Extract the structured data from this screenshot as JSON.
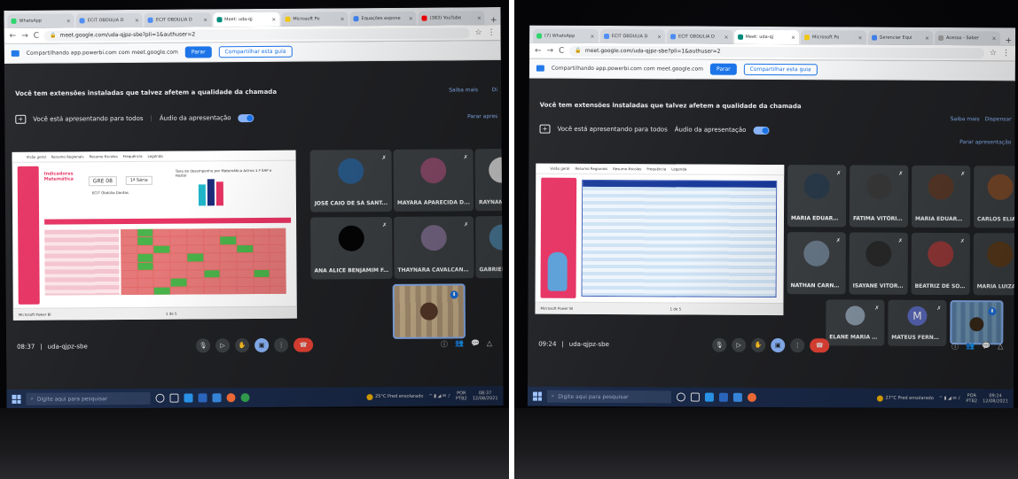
{
  "photo1": {
    "browser": {
      "tabs": [
        {
          "label": "WhatsApp",
          "color": "#25d366"
        },
        {
          "label": "ECIT OBDÚLIA D",
          "color": "#4a8af4"
        },
        {
          "label": "ECIT OBDÚLIA D",
          "color": "#4a8af4"
        },
        {
          "label": "Meet: uda-qj",
          "color": "#00897b",
          "active": true
        },
        {
          "label": "Microsoft Po",
          "color": "#f2c811"
        },
        {
          "label": "Equações expone",
          "color": "#4285f4"
        },
        {
          "label": "(383) YouTube",
          "color": "#ff0000"
        }
      ],
      "new_tab": "+",
      "url": "meet.google.com/uda-qjpz-sbe?pli=1&authuser=2"
    },
    "share_bar": {
      "text": "Compartilhando app.powerbi.com com meet.google.com",
      "stop_label": "Parar",
      "share_tab_label": "Compartilhar esta guia"
    },
    "meet": {
      "warning": "Você tem extensões instaladas que talvez afetem a qualidade da chamada",
      "learn_more": "Saiba mais",
      "dismiss": "Di",
      "presenting": "Você está apresentando para todos",
      "audio_label": "Áudio da apresentação",
      "stop_presenting": "Parar apres",
      "slide": {
        "nav": [
          "Visão geral",
          "Resumo Regionais",
          "Resumo Escolas",
          "Frequência",
          "Legenda"
        ],
        "title": "Indicadores Matemática",
        "gre": "GRE 08",
        "serie": "1ª Série",
        "school": "ECIT Obdúlia Dantas",
        "chart_caption": "Taxa de desempenho por Matemática Acima 1.ª SAP e Hostel",
        "footer_left": "Microsoft Power BI",
        "footer_mid": "1 de 5"
      },
      "participants": [
        {
          "name": "JOSÉ CAIO DE SÁ SANT...",
          "avatar": "#2a5a8a"
        },
        {
          "name": "MAYARA APARECIDA D...",
          "avatar": "#8a4a6a"
        },
        {
          "name": "RAYNAN VERAS DE",
          "avatar": "#cfcfcf"
        },
        {
          "name": "ANA ALICE BENJAMIM F...",
          "avatar": "#050505"
        },
        {
          "name": "THAYNARA CAVALCANT...",
          "avatar": "#7a6a8a"
        },
        {
          "name": "GABRIEL OLIVEIRA S",
          "avatar": "#4a7a9a"
        }
      ],
      "time": "08:37",
      "meeting_code": "uda-qjpz-sbe"
    },
    "taskbar": {
      "search_placeholder": "Digite aqui para pesquisar",
      "weather": "25°C Pred ensolarado",
      "lang": "POR",
      "lang2": "PTB2",
      "clock_time": "08:37",
      "clock_date": "12/08/2021"
    }
  },
  "photo2": {
    "browser": {
      "tabs": [
        {
          "label": "(7) WhatsApp",
          "color": "#25d366"
        },
        {
          "label": "ECIT OBDÚLIA D",
          "color": "#4a8af4"
        },
        {
          "label": "ECIT OBDÚLIA D",
          "color": "#4a8af4"
        },
        {
          "label": "Meet: uda-qj",
          "color": "#00897b",
          "active": true
        },
        {
          "label": "Microsoft Po",
          "color": "#f2c811"
        },
        {
          "label": "Gerenciar Equi",
          "color": "#4285f4"
        },
        {
          "label": "Acesso - Saber",
          "color": "#9e9e9e"
        }
      ],
      "new_tab": "+",
      "url": "meet.google.com/uda-qjpz-sbe?pli=1&authuser=2"
    },
    "share_bar": {
      "text": "Compartilhando app.powerbi.com com meet.google.com",
      "stop_label": "Parar",
      "share_tab_label": "Compartilhar esta guia"
    },
    "meet": {
      "warning": "Você tem extensões instaladas que talvez afetem a qualidade da chamada",
      "learn_more": "Saiba mais",
      "dismiss": "Dispensar",
      "presenting": "Você está apresentando para todos",
      "audio_label": "Áudio da apresentação",
      "stop_presenting": "Parar apresentação",
      "slide": {
        "nav": [
          "Visão geral",
          "Resumo Regionais",
          "Resumo Escolas",
          "Frequência",
          "Legenda"
        ],
        "footer_left": "Microsoft Power BI",
        "footer_mid": "1 de 5"
      },
      "participants": [
        {
          "name": "MARIA EDUARD...",
          "avatar": "#2a3a4a"
        },
        {
          "name": "FÁTIMA VITÓRIA...",
          "avatar": "#3a3a3a"
        },
        {
          "name": "MARIA EDUARD...",
          "avatar": "#5a3a2a"
        },
        {
          "name": "CARLOS ELIAS D...",
          "avatar": "#7a4a2a"
        },
        {
          "name": "NATHAN CARNE...",
          "avatar": "#6a7a8a"
        },
        {
          "name": "ISAYANE VITORI...",
          "avatar": "#2a2a2a"
        },
        {
          "name": "BEATRIZ DE SOU...",
          "avatar": "#9a3a3a"
        },
        {
          "name": "MARIA LUIZA AL...",
          "avatar": "#5a3a1a"
        },
        {
          "name": "ELANE MARIA D...",
          "avatar": "#8a9aaa"
        },
        {
          "name": "MATEUS FERNA...",
          "avatar": "#5c6bc0",
          "initial": "M"
        }
      ],
      "time": "09:24",
      "meeting_code": "uda-qjpz-sbe"
    },
    "taskbar": {
      "search_placeholder": "Digite aqui para pesquisar",
      "weather": "27°C Pred ensolarado",
      "lang": "POR",
      "lang2": "PTB2",
      "clock_time": "09:24",
      "clock_date": "12/08/2021"
    }
  }
}
